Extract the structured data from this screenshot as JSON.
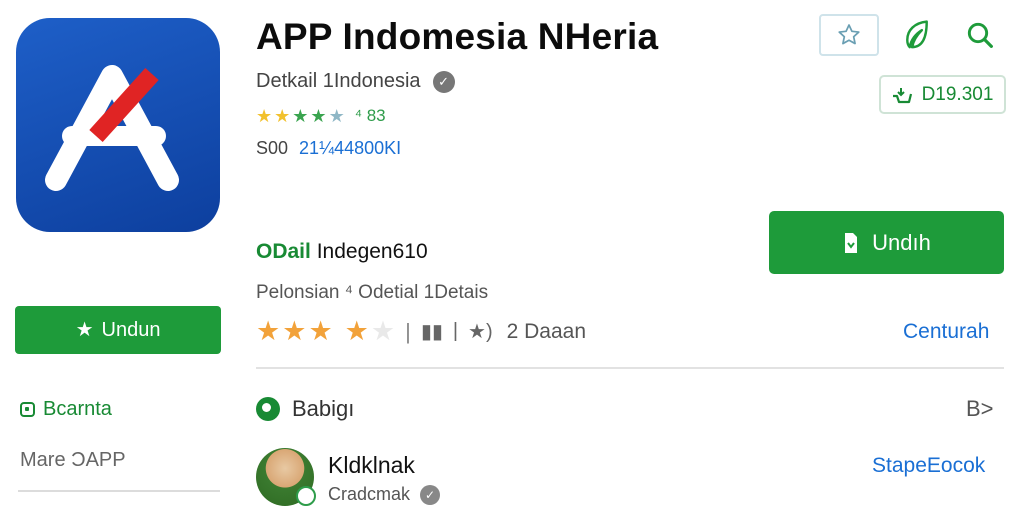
{
  "app": {
    "title": "APP Indomesia NHeria",
    "developer": "Detkail 1Indonesia",
    "rating_value": "⁴ 83",
    "meta_label": "S00",
    "meta_id": "21¼44800KI"
  },
  "header_actions": {
    "price_badge": "D19.301"
  },
  "left": {
    "install_label": "Undun",
    "link_label": "Bcarnta",
    "more_label": "Mare ƆAPP"
  },
  "main": {
    "install_label": "Undıh",
    "section_prefix": "ODail",
    "section_title": "Indegen610",
    "section_sub": "Pelonsian ⁴ Odetial 1Detais",
    "review_count": "2 Daaan",
    "see_more": "Centurah"
  },
  "similar": {
    "heading": "Babigı",
    "more": "B>",
    "item_name": "Kldklnak",
    "item_developer": "Cradcmak",
    "item_action": "StapeEocok"
  },
  "colors": {
    "accent_green": "#1e9b3a",
    "link_blue": "#1a6fd4",
    "icon_blue": "#1e5fc8",
    "icon_red": "#e02424"
  }
}
